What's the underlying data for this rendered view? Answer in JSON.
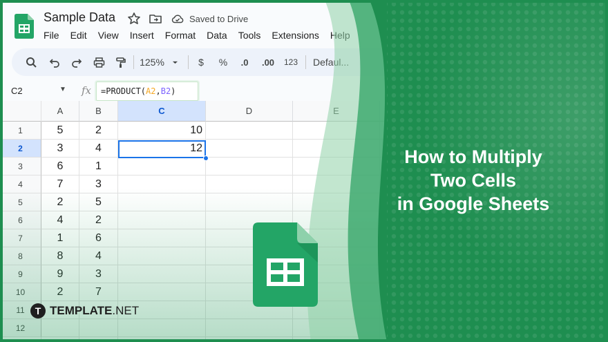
{
  "app": {
    "title": "Sample Data",
    "saved_status": "Saved to Drive",
    "menu": [
      "File",
      "Edit",
      "View",
      "Insert",
      "Format",
      "Data",
      "Tools",
      "Extensions",
      "Help"
    ]
  },
  "toolbar": {
    "zoom": "125%",
    "currency": "$",
    "percent": "%",
    "decrease_decimal": ".0",
    "increase_decimal": ".00",
    "number_format": "123",
    "font": "Defaul..."
  },
  "formula_bar": {
    "name_box": "C2",
    "fx": "fx",
    "formula_prefix": "=PRODUCT(",
    "ref_a": "A2",
    "comma": ",",
    "ref_b": "B2",
    "formula_suffix": ")"
  },
  "sheet": {
    "columns": [
      "A",
      "B",
      "C",
      "D",
      "E"
    ],
    "selected_column": "C",
    "selected_row": 2,
    "rows": [
      {
        "n": "1",
        "a": "5",
        "b": "2",
        "c": "10"
      },
      {
        "n": "2",
        "a": "3",
        "b": "4",
        "c": "12"
      },
      {
        "n": "3",
        "a": "6",
        "b": "1",
        "c": ""
      },
      {
        "n": "4",
        "a": "7",
        "b": "3",
        "c": ""
      },
      {
        "n": "5",
        "a": "2",
        "b": "5",
        "c": ""
      },
      {
        "n": "6",
        "a": "4",
        "b": "2",
        "c": ""
      },
      {
        "n": "7",
        "a": "1",
        "b": "6",
        "c": ""
      },
      {
        "n": "8",
        "a": "8",
        "b": "4",
        "c": ""
      },
      {
        "n": "9",
        "a": "9",
        "b": "3",
        "c": ""
      },
      {
        "n": "10",
        "a": "2",
        "b": "7",
        "c": ""
      },
      {
        "n": "11",
        "a": "",
        "b": "",
        "c": ""
      },
      {
        "n": "12",
        "a": "",
        "b": "",
        "c": ""
      }
    ]
  },
  "promo": {
    "headline_lines": [
      "How to Multiply",
      "Two Cells",
      "in Google Sheets"
    ],
    "brand_mark": "T",
    "brand_name_bold": "TEMPLATE",
    "brand_name_suffix": ".NET"
  },
  "colors": {
    "brand_green": "#1e8e50",
    "sheets_green": "#23a566",
    "selection_blue": "#1a73e8",
    "ref_a_color": "#f6a823",
    "ref_b_color": "#7b61ff"
  },
  "icons": [
    "sheets-logo-icon",
    "star-icon",
    "move-folder-icon",
    "cloud-saved-icon",
    "search-icon",
    "undo-icon",
    "redo-icon",
    "print-icon",
    "paint-format-icon",
    "dropdown-arrow-icon",
    "large-sheets-icon"
  ]
}
